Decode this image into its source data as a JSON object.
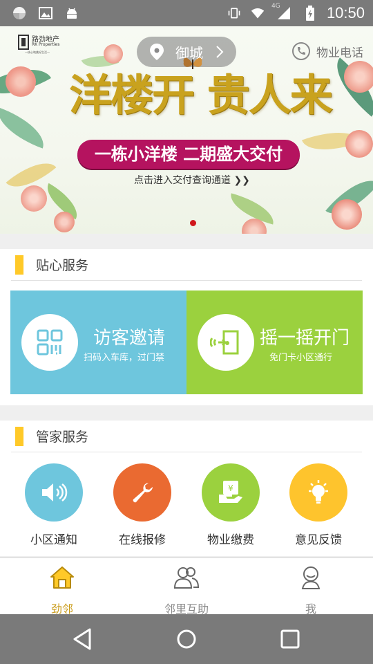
{
  "status_bar": {
    "time": "10:50",
    "network": "4G"
  },
  "banner": {
    "logo": {
      "name_cn": "路劲地产",
      "name_en": "RK Properties",
      "slogan": "一枝心筑美好生活一"
    },
    "location": "御城",
    "phone_label": "物业电话",
    "headline": "洋楼开 贵人来",
    "ribbon": "一栋小洋楼 二期盛大交付",
    "cta": "点击进入交付查询通道 ❯❯"
  },
  "sections": {
    "care": {
      "title": "贴心服务",
      "tiles": [
        {
          "title": "访客邀请",
          "subtitle": "扫码入车库，过门禁",
          "color": "#6ec6dd",
          "icon": "qr-code-icon"
        },
        {
          "title": "摇一摇开门",
          "subtitle": "免门卡小区通行",
          "color": "#9bd13e",
          "icon": "door-icon"
        }
      ]
    },
    "butler": {
      "title": "管家服务",
      "items": [
        {
          "label": "小区通知",
          "color": "#6ec6dd",
          "icon": "speaker-icon"
        },
        {
          "label": "在线报修",
          "color": "#ea6a31",
          "icon": "wrench-icon"
        },
        {
          "label": "物业缴费",
          "color": "#9bd13e",
          "icon": "payment-icon"
        },
        {
          "label": "意见反馈",
          "color": "#fec42d",
          "icon": "lightbulb-icon"
        }
      ]
    }
  },
  "tab_bar": {
    "items": [
      {
        "label": "劲邻",
        "icon": "home-icon",
        "active": true
      },
      {
        "label": "邻里互助",
        "icon": "people-icon",
        "active": false
      },
      {
        "label": "我",
        "icon": "person-icon",
        "active": false
      }
    ]
  },
  "colors": {
    "accent": "#ffc928",
    "active_tab": "#c99a16",
    "ribbon": "#b5135f"
  }
}
